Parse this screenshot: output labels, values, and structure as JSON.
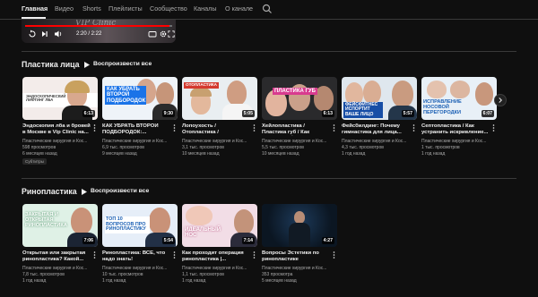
{
  "tabs": [
    {
      "label": "Главная",
      "active": true
    },
    {
      "label": "Видео",
      "active": false
    },
    {
      "label": "Shorts",
      "active": false
    },
    {
      "label": "Плейлисты",
      "active": false
    },
    {
      "label": "Сообщество",
      "active": false
    },
    {
      "label": "Каналы",
      "active": false
    },
    {
      "label": "О канале",
      "active": false
    }
  ],
  "player": {
    "time": "2:20 / 2:22",
    "progress": 0.98,
    "logo": "VIP Clinic"
  },
  "colors": {
    "background": "#0f0f0f",
    "accent": "#ff0000",
    "text": "#f1f1f1",
    "muted": "#aaaaaa"
  },
  "sections": [
    {
      "title": "Пластика лица",
      "play_all": "Воспроизвести все",
      "videos": [
        {
          "title": "Эндоскопия лба и бровей в Москве в Vip Clinic на...",
          "channel": "Пластические хирургия и Кос...",
          "views": "598 просмотров",
          "age": "6 месяцев назад",
          "duration": "6:13",
          "thumb_text": "ЭНДОСКОПИЧЕСКИЙ ЛИФТИНГ ЛБА",
          "badge": "Субтитры"
        },
        {
          "title": "КАК УБРАТЬ ВТОРОЙ ПОДБОРОДОК:...",
          "channel": "Пластические хирургия и Кос...",
          "views": "6,9 тыс. просмотров",
          "age": "9 месяцев назад",
          "duration": "9:30",
          "thumb_text": "КАК УБРАТЬ ВТОРОЙ ПОДБОРОДОК",
          "badge": ""
        },
        {
          "title": "Лопоухость / Отопластика / Лопоухость у детей / Как...",
          "channel": "Пластические хирургия и Кос...",
          "views": "3,1 тыс. просмотров",
          "age": "10 месяцев назад",
          "duration": "5:05",
          "thumb_text": "ОТОПЛАСТИКА",
          "badge": ""
        },
        {
          "title": "Хейлопластика / Пластика губ / Как сделать губы...",
          "channel": "Пластические хирургия и Кос...",
          "views": "5,5 тыс. просмотров",
          "age": "10 месяцев назад",
          "duration": "6:13",
          "thumb_text": "ПЛАСТИКА ГУБ",
          "badge": ""
        },
        {
          "title": "Фейсбилдинг: Почему гимнастика для лица...",
          "channel": "Пластические хирургия и Кос...",
          "views": "4,3 тыс. просмотров",
          "age": "1 год назад",
          "duration": "5:57",
          "thumb_text": "ФЕЙСФИТНЕС ИСПОРТИТ ВАШЕ ЛИЦО",
          "badge": ""
        },
        {
          "title": "Септопластика / Как устранить искривление...",
          "channel": "Пластические хирургия и Кос...",
          "views": "1 тыс. просмотров",
          "age": "1 год назад",
          "duration": "6:07",
          "thumb_text": "ИСПРАВЛЕНИЕ НОСОВОЙ ПЕРЕГОРОДКИ",
          "badge": ""
        }
      ]
    },
    {
      "title": "Ринопластика",
      "play_all": "Воспроизвести все",
      "videos": [
        {
          "title": "Открытая или закрытая ринопластика? Какой...",
          "channel": "Пластические хирургия и Кос...",
          "views": "7,8 тыс. просмотров",
          "age": "1 год назад",
          "duration": "7:06",
          "thumb_text": "ЗАКРЫТАЯ И ОТКРЫТАЯ РИНОПЛАСТИКА",
          "badge": ""
        },
        {
          "title": "Ринопластика: ВСЕ, что надо знать!",
          "channel": "Пластические хирургия и Кос...",
          "views": "10 тыс. просмотров",
          "age": "1 год назад",
          "duration": "5:54",
          "thumb_text": "ТОП 10 ВОПРОСОВ ПРО РИНОПЛАСТИКУ",
          "badge": ""
        },
        {
          "title": "Как проходит операция ринопластика |...",
          "channel": "Пластические хирургия и Кос...",
          "views": "1,1 тыс. просмотров",
          "age": "1 год назад",
          "duration": "7:14",
          "thumb_text": "ИДЕАЛЬНЫЙ НОС",
          "badge": ""
        },
        {
          "title": "Вопросы Эстетики по ринопластике",
          "channel": "Пластические хирургия и Кос...",
          "views": "353 просмотра",
          "age": "5 месяцев назад",
          "duration": "4:27",
          "thumb_text": "",
          "badge": ""
        }
      ]
    }
  ]
}
